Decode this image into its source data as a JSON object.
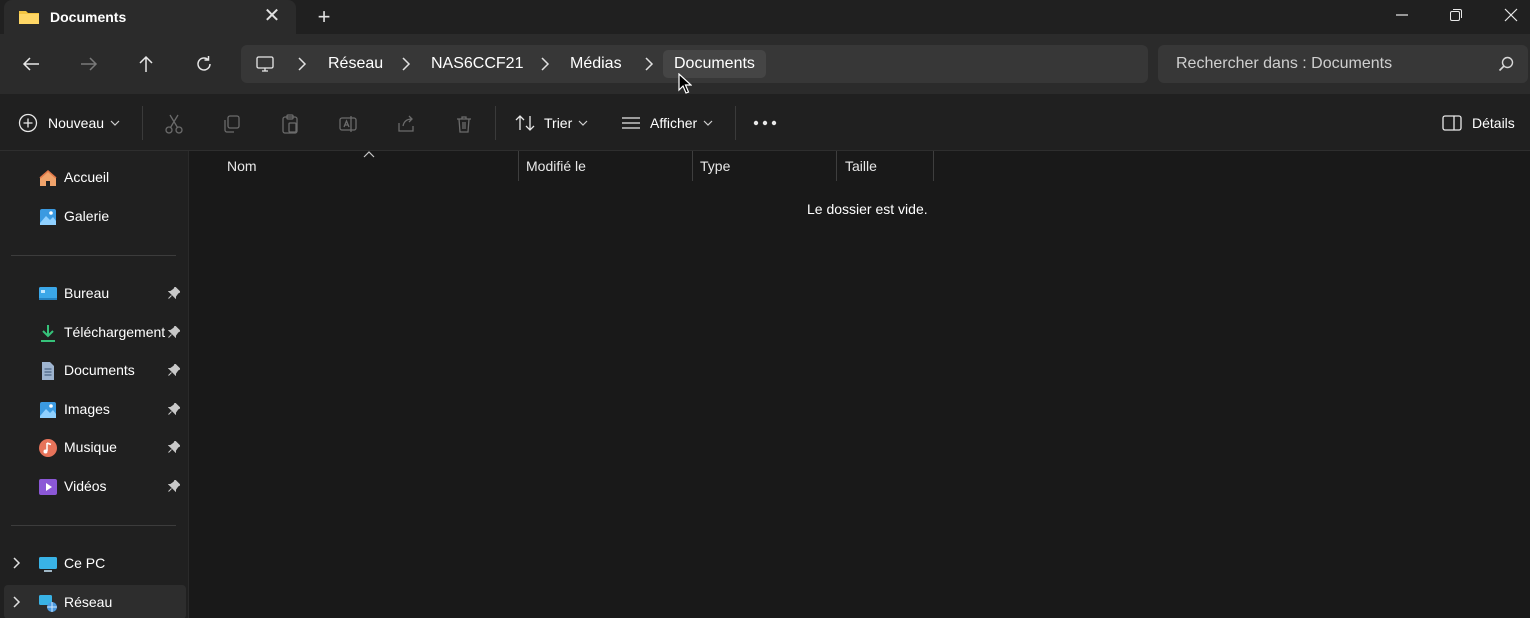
{
  "tab": {
    "title": "Documents",
    "folder_icon": "folder-icon",
    "close_icon": "close-icon"
  },
  "window": {
    "new_tab_icon": "plus-icon"
  },
  "address": {
    "crumbs": [
      "Réseau",
      "NAS6CCF21",
      "Médias"
    ],
    "current": "Documents"
  },
  "search": {
    "placeholder": "Rechercher dans : Documents"
  },
  "toolbar": {
    "new_label": "Nouveau",
    "sort_label": "Trier",
    "view_label": "Afficher",
    "details_label": "Détails"
  },
  "sidebar": {
    "quick": [
      {
        "label": "Accueil",
        "icon": "home-icon"
      },
      {
        "label": "Galerie",
        "icon": "gallery-icon"
      }
    ],
    "pinned": [
      {
        "label": "Bureau",
        "icon": "desktop-icon"
      },
      {
        "label": "Téléchargement",
        "icon": "download-icon"
      },
      {
        "label": "Documents",
        "icon": "documents-icon"
      },
      {
        "label": "Images",
        "icon": "images-icon"
      },
      {
        "label": "Musique",
        "icon": "music-icon"
      },
      {
        "label": "Vidéos",
        "icon": "videos-icon"
      }
    ],
    "tree": [
      {
        "label": "Ce PC",
        "icon": "pc-icon"
      },
      {
        "label": "Réseau",
        "icon": "network-icon"
      }
    ]
  },
  "columns": {
    "name": "Nom",
    "modified": "Modifié le",
    "type": "Type",
    "size": "Taille"
  },
  "content": {
    "empty_message": "Le dossier est vide."
  },
  "colors": {
    "folder": "#f4c542",
    "accent": "#4cc2ff",
    "background": "#191919",
    "panel": "#202020"
  }
}
